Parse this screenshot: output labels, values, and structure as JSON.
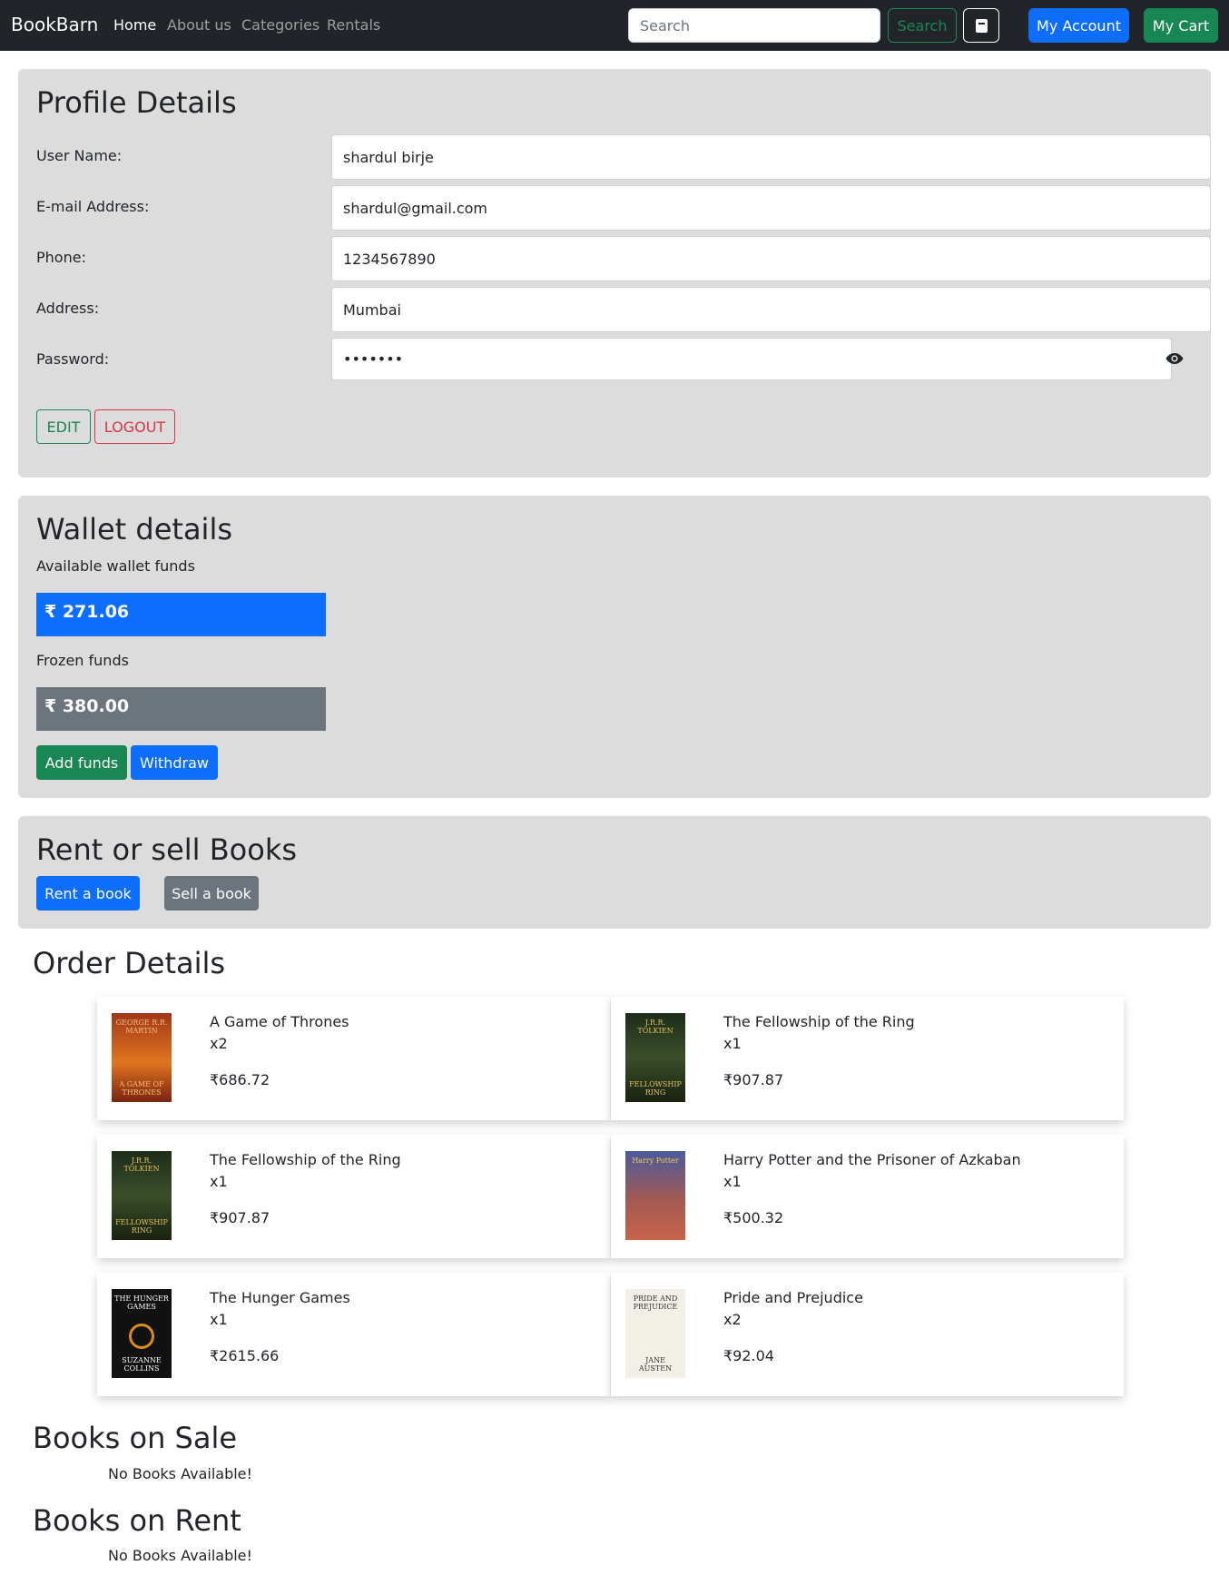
{
  "navbar": {
    "brand": "BookBarn",
    "links": [
      "Home",
      "About us",
      "Categories",
      "Rentals"
    ],
    "search_placeholder": "Search",
    "search_button": "Search",
    "account_button": "My Account",
    "cart_button": "My Cart"
  },
  "profile": {
    "title": "Profile Details",
    "fields": [
      {
        "label": "User Name:",
        "value": "shardul birje"
      },
      {
        "label": "E-mail Address:",
        "value": "shardul@gmail.com"
      },
      {
        "label": "Phone:",
        "value": "1234567890"
      },
      {
        "label": "Address:",
        "value": "Mumbai"
      }
    ],
    "password_label": "Password:",
    "password_value": "•••••••",
    "edit_button": "EDIT",
    "logout_button": "LOGOUT"
  },
  "wallet": {
    "title": "Wallet details",
    "available_label": "Available wallet funds",
    "available_value": "₹ 271.06",
    "frozen_label": "Frozen funds",
    "frozen_value": "₹ 380.00",
    "add_button": "Add funds",
    "withdraw_button": "Withdraw"
  },
  "rent_sell": {
    "title": "Rent or sell Books",
    "rent_button": "Rent a book",
    "sell_button": "Sell a book"
  },
  "orders": {
    "title": "Order Details",
    "items": [
      {
        "title": "A Game of Thrones",
        "qty": "x2",
        "price": "₹686.72",
        "cover": "got",
        "cover_text_top": "GEORGE R.R. MARTIN",
        "cover_text_bottom": "A GAME OF THRONES"
      },
      {
        "title": "The Fellowship of the Ring",
        "qty": "x1",
        "price": "₹907.87",
        "cover": "lotr",
        "cover_text_top": "J.R.R. TOLKIEN",
        "cover_text_bottom": "FELLOWSHIP RING"
      },
      {
        "title": "The Fellowship of the Ring",
        "qty": "x1",
        "price": "₹907.87",
        "cover": "lotr",
        "cover_text_top": "J.R.R. TOLKIEN",
        "cover_text_bottom": "FELLOWSHIP RING"
      },
      {
        "title": "Harry Potter and the Prisoner of Azkaban",
        "qty": "x1",
        "price": "₹500.32",
        "cover": "hp",
        "cover_text_top": "Harry Potter",
        "cover_text_bottom": ""
      },
      {
        "title": "The Hunger Games",
        "qty": "x1",
        "price": "₹2615.66",
        "cover": "hg",
        "cover_text_top": "THE HUNGER GAMES",
        "cover_text_bottom": "SUZANNE COLLINS"
      },
      {
        "title": "Pride and Prejudice",
        "qty": "x2",
        "price": "₹92.04",
        "cover": "pp",
        "cover_text_top": "PRIDE AND PREJUDICE",
        "cover_text_bottom": "JANE AUSTEN"
      }
    ]
  },
  "sale": {
    "title": "Books on Sale",
    "empty": "No Books Available!"
  },
  "rent": {
    "title": "Books on Rent",
    "empty": "No Books Available!"
  },
  "colors": {
    "primary": "#0d6efd",
    "success": "#198754",
    "danger": "#dc3545",
    "secondary": "#6c757d",
    "navbar": "#212529",
    "panel": "#dcdcdc"
  }
}
